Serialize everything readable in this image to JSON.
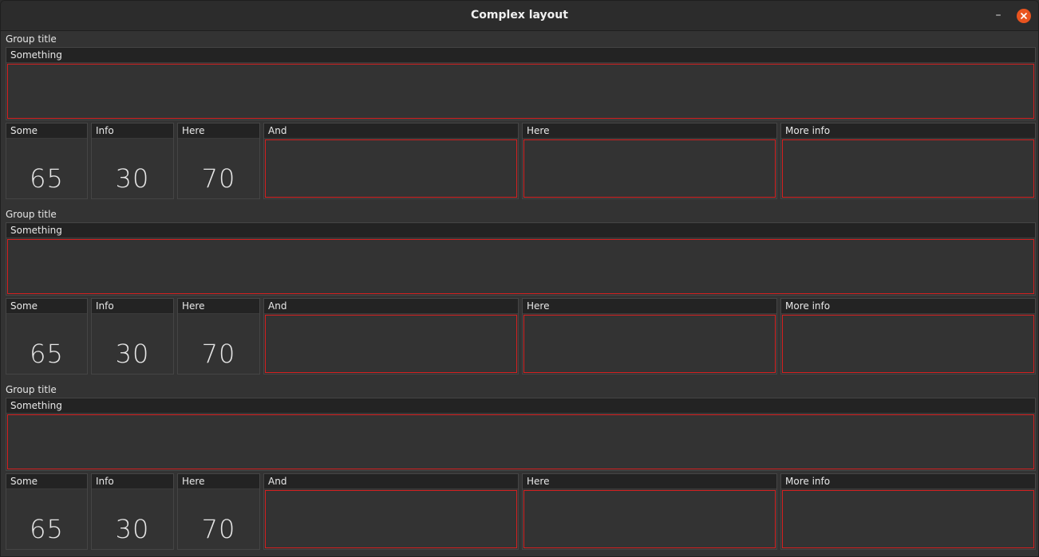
{
  "window": {
    "title": "Complex layout",
    "minimize_label": "–"
  },
  "groups": [
    {
      "title": "Group title",
      "wide_panel": "Something",
      "small_panels": [
        {
          "label": "Some",
          "value": "65"
        },
        {
          "label": "Info",
          "value": "30"
        },
        {
          "label": "Here",
          "value": "70"
        }
      ],
      "boxed_panels": [
        "And",
        "Here",
        "More info"
      ]
    },
    {
      "title": "Group title",
      "wide_panel": "Something",
      "small_panels": [
        {
          "label": "Some",
          "value": "65"
        },
        {
          "label": "Info",
          "value": "30"
        },
        {
          "label": "Here",
          "value": "70"
        }
      ],
      "boxed_panels": [
        "And",
        "Here",
        "More info"
      ]
    },
    {
      "title": "Group title",
      "wide_panel": "Something",
      "small_panels": [
        {
          "label": "Some",
          "value": "65"
        },
        {
          "label": "Info",
          "value": "30"
        },
        {
          "label": "Here",
          "value": "70"
        }
      ],
      "boxed_panels": [
        "And",
        "Here",
        "More info"
      ]
    }
  ],
  "colors": {
    "accent_border": "#d42020",
    "close_button": "#e9541f"
  }
}
